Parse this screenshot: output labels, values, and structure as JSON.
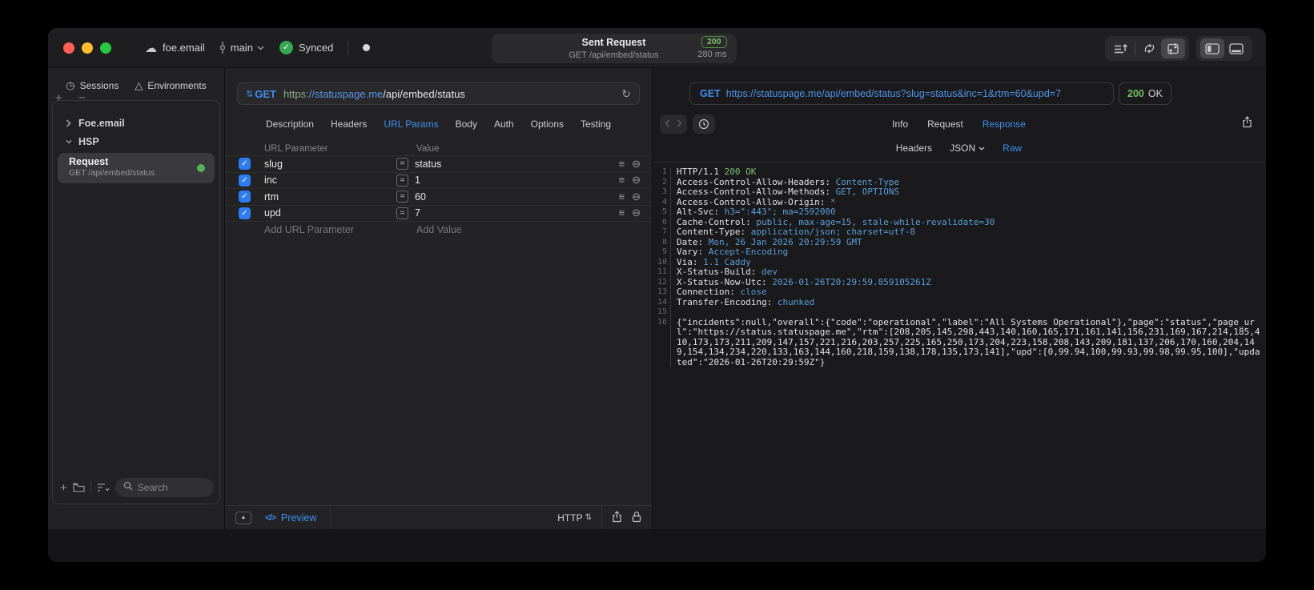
{
  "titlebar": {
    "project_name": "foe.email",
    "branch_name": "main",
    "sync_label": "Synced",
    "request_title": "Sent Request",
    "request_subtitle": "GET /api/embed/status",
    "status_code": "200",
    "duration": "280 ms"
  },
  "sidebar": {
    "tabs": [
      {
        "label": "Sessions"
      },
      {
        "label": "Environments"
      }
    ],
    "tree": {
      "group1": "Foe.email",
      "group2": "HSP"
    },
    "request_item": {
      "title": "Request",
      "subtitle": "GET /api/embed/status"
    },
    "search_placeholder": "Search"
  },
  "request_panel": {
    "method": "GET",
    "url": {
      "scheme": "https",
      "host": "://statuspage.me",
      "path": "/api/embed/status"
    },
    "tabs": [
      "Description",
      "Headers",
      "URL Params",
      "Body",
      "Auth",
      "Options",
      "Testing"
    ],
    "active_tab": "URL Params",
    "params_table": {
      "col_param": "URL Parameter",
      "col_value": "Value",
      "rows": [
        {
          "name": "slug",
          "value": "status",
          "checked": true
        },
        {
          "name": "inc",
          "value": "1",
          "checked": true
        },
        {
          "name": "rtm",
          "value": "60",
          "checked": true
        },
        {
          "name": "upd",
          "value": "7",
          "checked": true
        }
      ],
      "add_param_label": "Add URL Parameter",
      "add_value_label": "Add Value"
    },
    "footer": {
      "preview_label": "Preview",
      "http_label": "HTTP"
    }
  },
  "response_panel": {
    "method": "GET",
    "url": "https://statuspage.me/api/embed/status?slug=status&inc=1&rtm=60&upd=7",
    "status_code": "200",
    "status_text": "OK",
    "tabs": [
      "Info",
      "Request",
      "Response"
    ],
    "active_tab": "Response",
    "subtabs": [
      "Headers",
      "JSON",
      "Raw"
    ],
    "active_subtab": "Raw",
    "body_lines": [
      {
        "num": "1",
        "key": "HTTP/1.1 ",
        "value": "200 OK"
      },
      {
        "num": "2",
        "key": "Access-Control-Allow-Headers:",
        "value": " Content-Type"
      },
      {
        "num": "3",
        "key": "Access-Control-Allow-Methods:",
        "value": " GET, OPTIONS"
      },
      {
        "num": "4",
        "key": "Access-Control-Allow-Origin:",
        "value": " *"
      },
      {
        "num": "5",
        "key": "Alt-Svc:",
        "value": " h3=\":443\"; ma=2592000"
      },
      {
        "num": "6",
        "key": "Cache-Control:",
        "value": " public, max-age=15, stale-while-revalidate=30"
      },
      {
        "num": "7",
        "key": "Content-Type:",
        "value": " application/json; charset=utf-8"
      },
      {
        "num": "8",
        "key": "Date:",
        "value": " Mon, 26 Jan 2026 20:29:59 GMT"
      },
      {
        "num": "9",
        "key": "Vary:",
        "value": " Accept-Encoding"
      },
      {
        "num": "10",
        "key": "Via:",
        "value": " 1.1 Caddy"
      },
      {
        "num": "11",
        "key": "X-Status-Build:",
        "value": " dev"
      },
      {
        "num": "12",
        "key": "X-Status-Now-Utc:",
        "value": " 2026-01-26T20:29:59.859105261Z"
      },
      {
        "num": "13",
        "key": "Connection:",
        "value": " close"
      },
      {
        "num": "14",
        "key": "Transfer-Encoding:",
        "value": " chunked"
      },
      {
        "num": "15",
        "key": "",
        "value": ""
      }
    ],
    "body_json_line": {
      "num": "16",
      "text": "{\"incidents\":null,\"overall\":{\"code\":\"operational\",\"label\":\"All Systems Operational\"},\"page\":\"status\",\"page_url\":\"https://status.statuspage.me\",\"rtm\":[208,205,145,298,443,140,160,165,171,161,141,156,231,169,167,214,185,410,173,173,211,209,147,157,221,216,203,257,225,165,250,173,204,223,158,208,143,209,181,137,206,170,160,204,149,154,134,234,220,133,163,144,160,218,159,138,178,135,173,141],\"upd\":[0,99.94,100,99.93,99.98,99.95,100],\"updated\":\"2026-01-26T20:29:59Z\"}"
    }
  },
  "icons": {
    "cloud": "☁",
    "check": "✓",
    "sessions": "◷",
    "environments": "△",
    "plus": "+",
    "minus": "−",
    "plusminus": "+ −",
    "stepper": "⇅",
    "refresh": "↻",
    "equals": "=",
    "drag": "≡",
    "remove": "⊖",
    "panel_up": "▲",
    "code": "</>"
  },
  "colors": {
    "accent_blue": "#3f8eef",
    "status_green": "#76c063",
    "checkbox_blue": "#2f7bf0",
    "sync_green": "#34a853"
  }
}
